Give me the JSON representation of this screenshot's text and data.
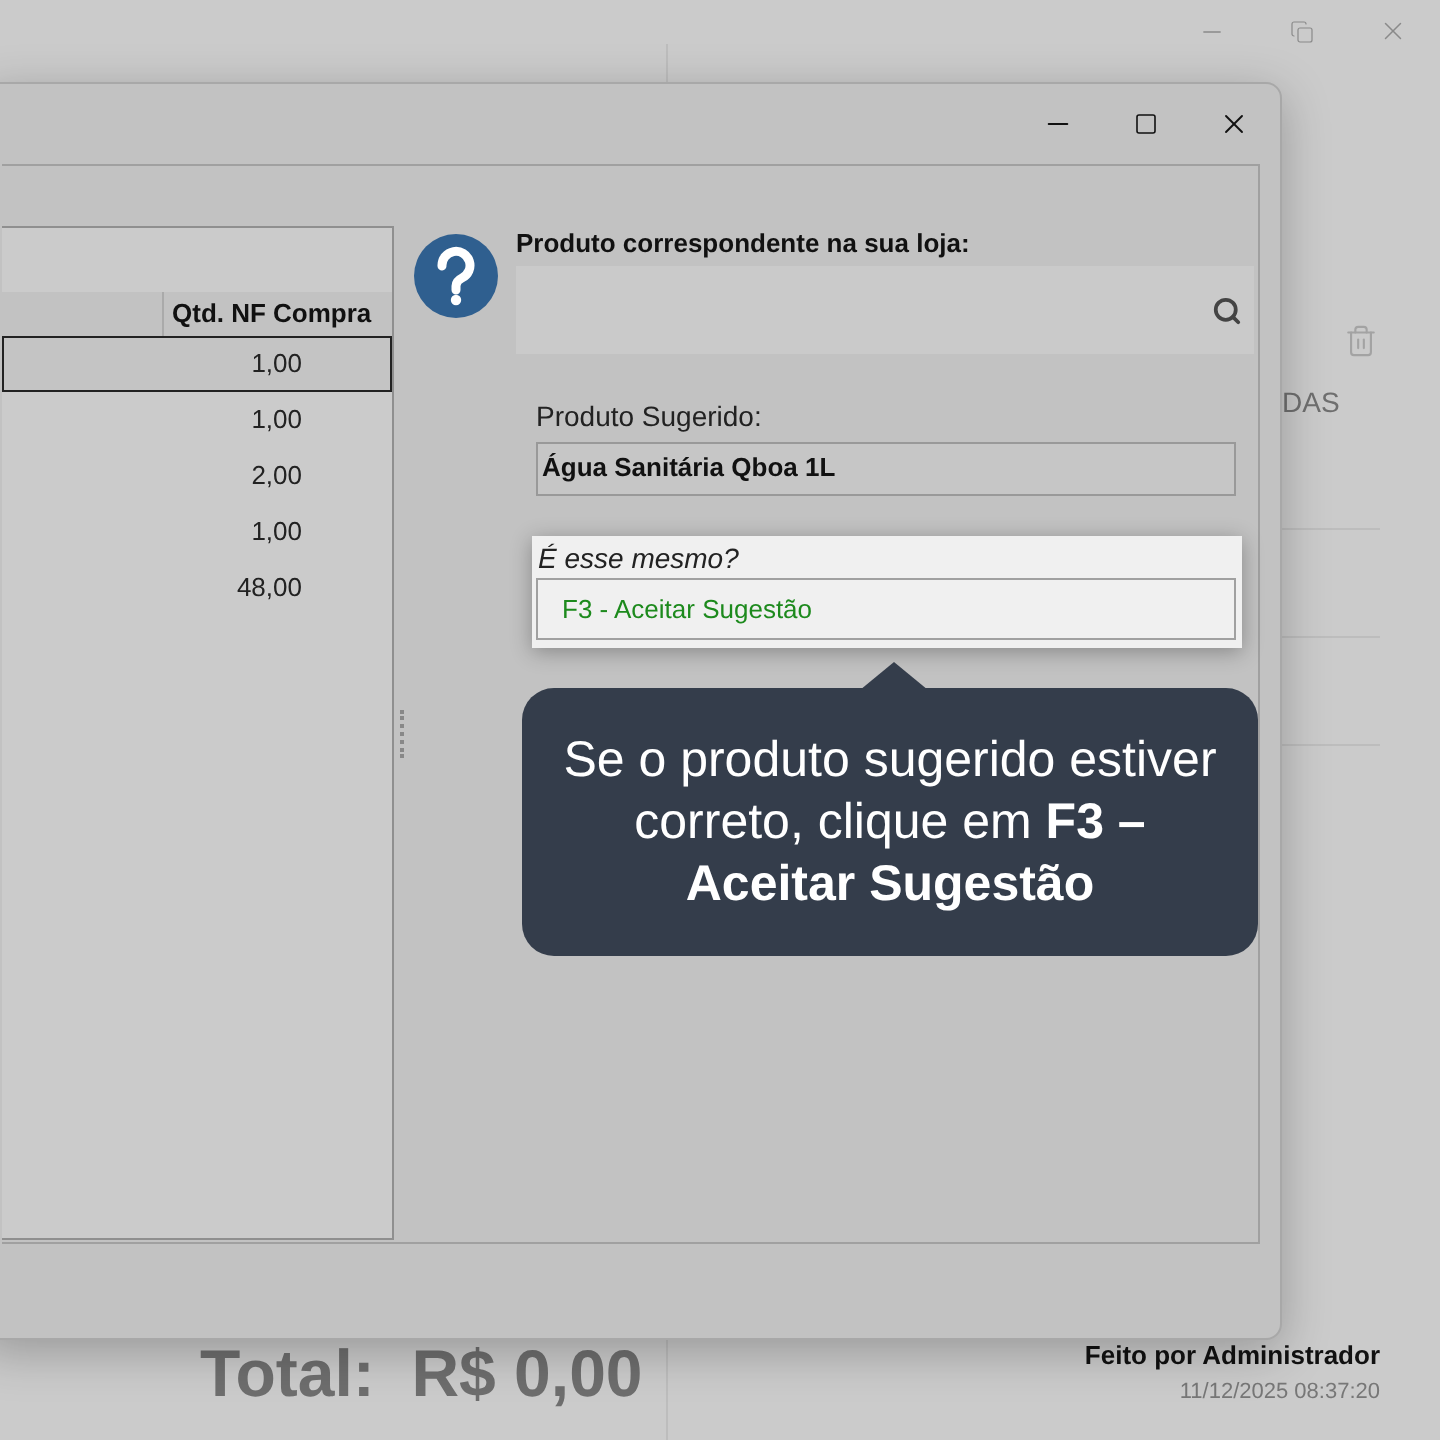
{
  "background": {
    "side_label": "DAS",
    "total": "Total:  R$ 0,00",
    "made_by": "Feito por Administrador",
    "timestamp": "11/12/2025 08:37:20"
  },
  "dialog": {
    "table": {
      "columns": [
        "Qtd. NF Compra"
      ],
      "rows": [
        {
          "cells": [
            "1,00"
          ],
          "selected": true
        },
        {
          "cells": [
            "1,00"
          ],
          "selected": false
        },
        {
          "cells": [
            "2,00"
          ],
          "selected": false
        },
        {
          "cells": [
            "1,00"
          ],
          "selected": false
        },
        {
          "cells": [
            "48,00"
          ],
          "selected": false
        }
      ]
    },
    "match_label": "Produto correspondente na sua loja:",
    "suggested_label": "Produto Sugerido:",
    "suggested_value": "Água Sanitária Qboa 1L",
    "confirm_question": "É esse mesmo?",
    "accept_button": "F3 - Aceitar Sugestão"
  },
  "tooltip": {
    "text": "Se o produto sugerido estiver correto, clique em **F3 – Aceitar Sugestão**"
  }
}
